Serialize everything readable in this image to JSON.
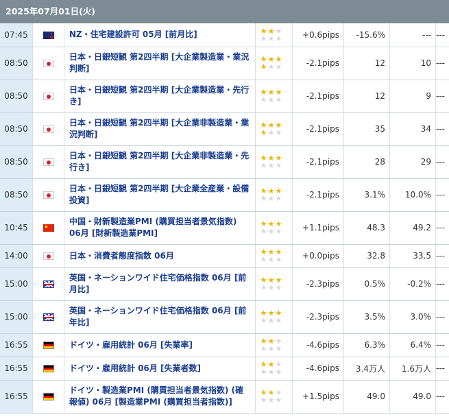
{
  "header": {
    "date": "2025年07月01日(火)"
  },
  "rows": [
    {
      "time": "07:45",
      "flag": "nz",
      "name": "NZ・住宅建設許可 05月 [前月比]",
      "stars": 2,
      "pips": "+0.6pips",
      "prev": "-15.6%",
      "fcst": "---",
      "res": "---",
      "h": 34
    },
    {
      "time": "08:50",
      "flag": "jp",
      "name": "日本・日銀短観 第2四半期 [大企業製造業・業況判断]",
      "stars": 4,
      "pips": "-2.1pips",
      "prev": "12",
      "fcst": "10",
      "res": "---",
      "h": 48
    },
    {
      "time": "08:50",
      "flag": "jp",
      "name": "日本・日銀短観 第2四半期 [大企業製造業・先行き]",
      "stars": 3,
      "pips": "-2.1pips",
      "prev": "12",
      "fcst": "9",
      "res": "---",
      "h": 48
    },
    {
      "time": "08:50",
      "flag": "jp",
      "name": "日本・日銀短観 第2四半期 [大企業非製造業・業況判断]",
      "stars": 4,
      "pips": "-2.1pips",
      "prev": "35",
      "fcst": "34",
      "res": "---",
      "h": 48
    },
    {
      "time": "08:50",
      "flag": "jp",
      "name": "日本・日銀短観 第2四半期 [大企業非製造業・先行き]",
      "stars": 3,
      "pips": "-2.1pips",
      "prev": "28",
      "fcst": "29",
      "res": "---",
      "h": 48
    },
    {
      "time": "08:50",
      "flag": "jp",
      "name": "日本・日銀短観 第2四半期 [大企業全産業・設備投資]",
      "stars": 3,
      "pips": "-2.1pips",
      "prev": "3.1%",
      "fcst": "10.0%",
      "res": "---",
      "h": 48
    },
    {
      "time": "10:45",
      "flag": "cn",
      "name": "中国・財新製造業PMI (購買担当者景気指数) 06月 [財新製造業PMI]",
      "stars": 3,
      "pips": "+1.1pips",
      "prev": "48.3",
      "fcst": "49.2",
      "res": "---",
      "h": 48
    },
    {
      "time": "14:00",
      "flag": "jp",
      "name": "日本・消費者態度指数 06月",
      "stars": 3,
      "pips": "+0.0pips",
      "prev": "32.8",
      "fcst": "33.5",
      "res": "---",
      "h": 34
    },
    {
      "time": "15:00",
      "flag": "uk",
      "name": "英国・ネーションワイド住宅価格指数 06月 [前月比]",
      "stars": 3,
      "pips": "-2.3pips",
      "prev": "0.5%",
      "fcst": "-0.2%",
      "res": "---",
      "h": 48
    },
    {
      "time": "15:00",
      "flag": "uk",
      "name": "英国・ネーションワイド住宅価格指数 06月 [前年比]",
      "stars": 3,
      "pips": "-2.3pips",
      "prev": "3.5%",
      "fcst": "3.0%",
      "res": "---",
      "h": 48
    },
    {
      "time": "16:55",
      "flag": "de",
      "name": "ドイツ・雇用統計 06月 [失業率]",
      "stars": 2,
      "pips": "-4.6pips",
      "prev": "6.3%",
      "fcst": "6.4%",
      "res": "---",
      "h": 34
    },
    {
      "time": "16:55",
      "flag": "de",
      "name": "ドイツ・雇用統計 06月 [失業者数]",
      "stars": 2,
      "pips": "-4.6pips",
      "prev": "3.4万人",
      "fcst": "1.6万人",
      "res": "---",
      "h": 34
    },
    {
      "time": "16:55",
      "flag": "de",
      "name": "ドイツ・製造業PMI (購買担当者景気指数) (確報値) 06月 [製造業PMI (購買担当者指数)]",
      "stars": 2,
      "pips": "+1.5pips",
      "prev": "49.0",
      "fcst": "49.0",
      "res": "---",
      "h": 48
    }
  ]
}
